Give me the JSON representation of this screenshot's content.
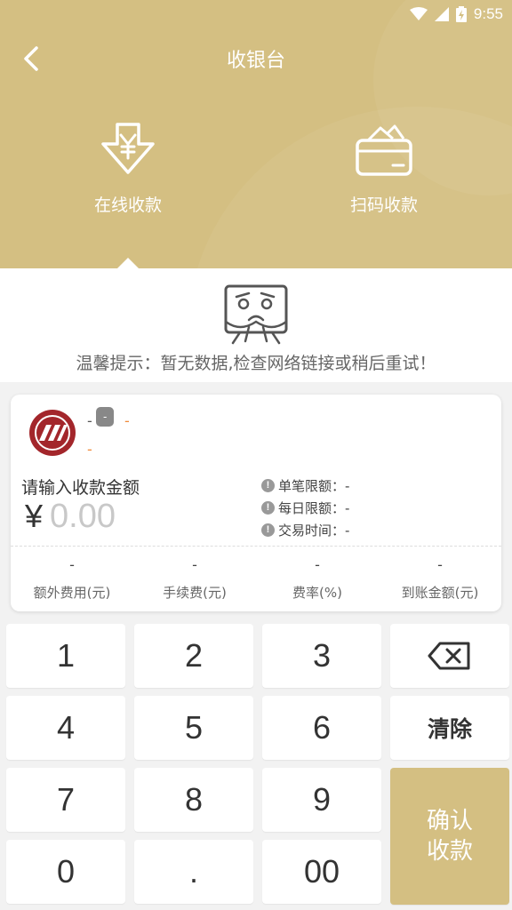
{
  "status_bar": {
    "time": "9:55"
  },
  "header": {
    "title": "收银台",
    "tabs": [
      {
        "label": "在线收款",
        "icon": "yen-download-icon",
        "active": true
      },
      {
        "label": "扫码收款",
        "icon": "card-wallet-icon",
        "active": false
      }
    ]
  },
  "empty_state": {
    "icon": "sad-box-icon",
    "message": "温馨提示：暂无数据,检查网络链接或稍后重试！"
  },
  "merchant": {
    "name": "-",
    "badge": "-",
    "badge_suffix": "-",
    "subtitle": "-"
  },
  "amount": {
    "label": "请输入收款金额",
    "currency": "¥",
    "placeholder": "0.00"
  },
  "limits": [
    {
      "label": "单笔限额：",
      "value": "-"
    },
    {
      "label": "每日限额：",
      "value": "-"
    },
    {
      "label": "交易时间：",
      "value": "-"
    }
  ],
  "stats": [
    {
      "value": "-",
      "label": "额外费用(元)"
    },
    {
      "value": "-",
      "label": "手续费(元)"
    },
    {
      "value": "-",
      "label": "费率(%)"
    },
    {
      "value": "-",
      "label": "到账金额(元)"
    }
  ],
  "keypad": {
    "keys": [
      "1",
      "2",
      "3",
      "4",
      "5",
      "6",
      "7",
      "8",
      "9",
      "0",
      ".",
      "00"
    ],
    "clear": "清除",
    "confirm_line1": "确认",
    "confirm_line2": "收款"
  },
  "colors": {
    "accent": "#d4bf82",
    "warning": "#f08a3a",
    "badge": "#888888"
  }
}
